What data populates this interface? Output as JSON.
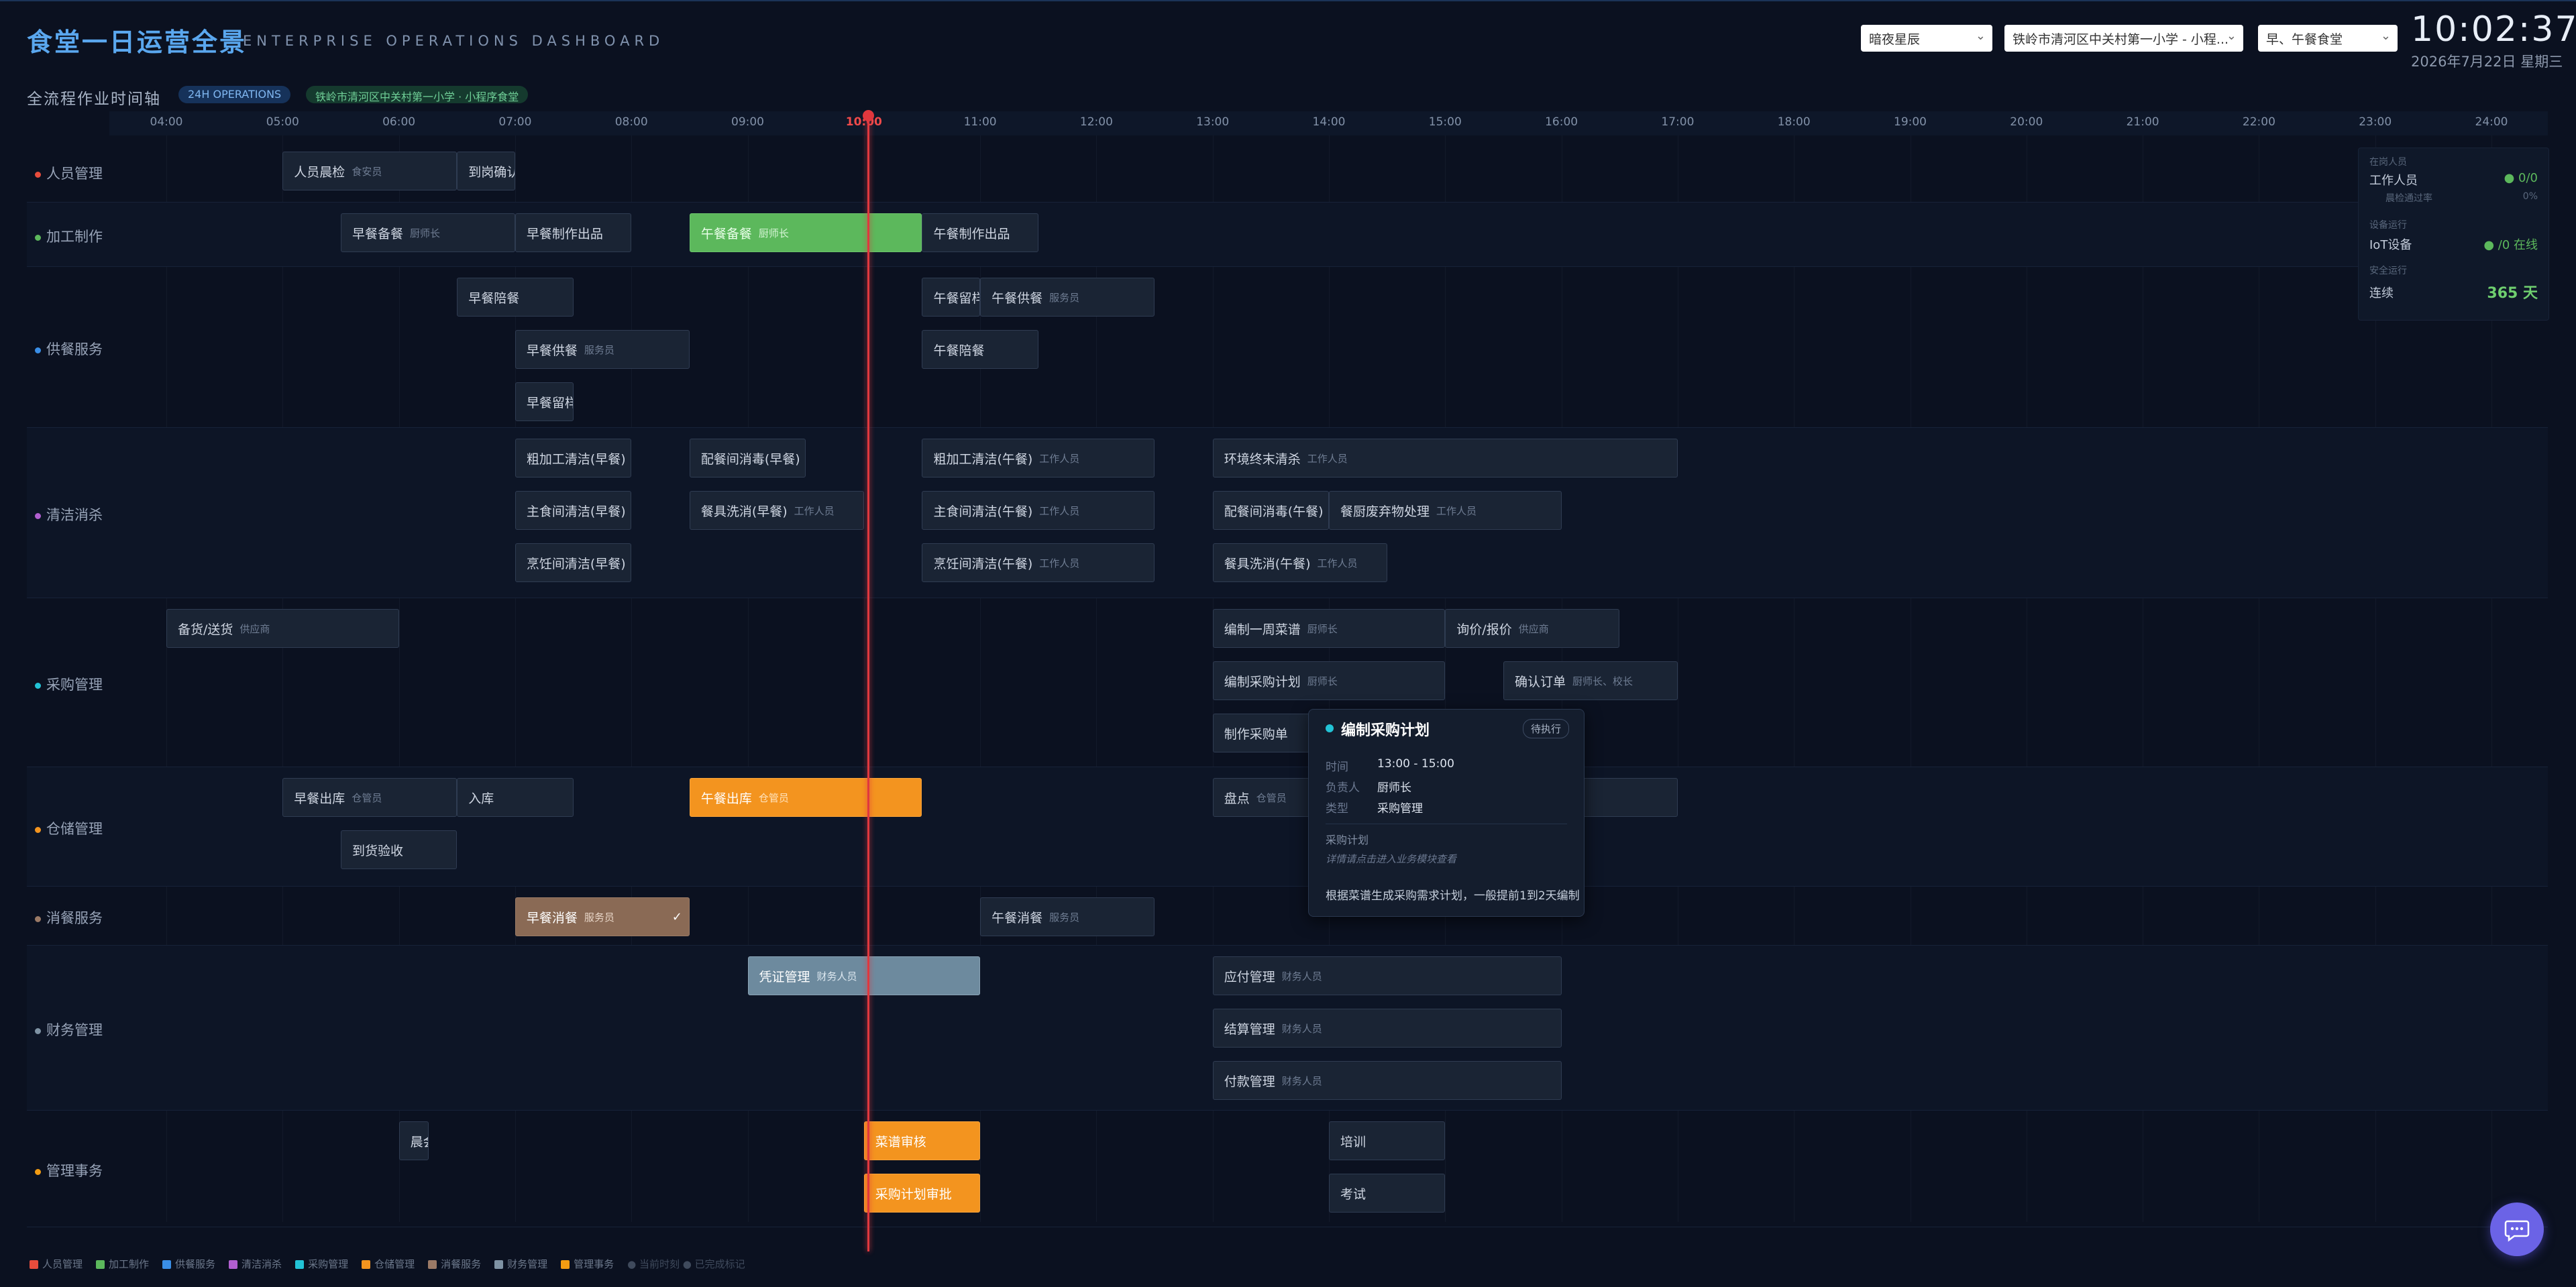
{
  "header": {
    "title": "食堂一日运营全景",
    "subtitle": "ENTERPRISE OPERATIONS DASHBOARD",
    "theme_select": "暗夜星辰",
    "school_select": "铁岭市清河区中关村第一小学 - 小程...",
    "meal_select": "早、午餐食堂",
    "clock": "10:02:37",
    "date": "2026年7月22日 星期三"
  },
  "subheader": {
    "label": "全流程作业时间轴",
    "pill_ops": "24H OPERATIONS",
    "pill_site": "铁岭市清河区中关村第一小学 · 小程序食堂"
  },
  "timeline": {
    "ticks": [
      "04:00",
      "05:00",
      "06:00",
      "07:00",
      "08:00",
      "09:00",
      "10:00",
      "11:00",
      "12:00",
      "13:00",
      "14:00",
      "15:00",
      "16:00",
      "17:00",
      "18:00",
      "19:00",
      "20:00",
      "21:00",
      "22:00",
      "23:00",
      "24:00"
    ],
    "now": "10:02"
  },
  "lanes": [
    {
      "name": "人员管理",
      "color": "#e74c3c"
    },
    {
      "name": "加工制作",
      "color": "#5cb85c"
    },
    {
      "name": "供餐服务",
      "color": "#3a8ee6"
    },
    {
      "name": "清洁消杀",
      "color": "#b15fd0"
    },
    {
      "name": "采购管理",
      "color": "#22c3d6"
    },
    {
      "name": "仓储管理",
      "color": "#f3941f"
    },
    {
      "name": "消餐服务",
      "color": "#9b7a66"
    },
    {
      "name": "财务管理",
      "color": "#7f93a4"
    },
    {
      "name": "管理事务",
      "color": "#f39c12"
    }
  ],
  "tasks": [
    {
      "lane": 0,
      "row": 0,
      "start": "05:00",
      "end": "06:30",
      "name": "人员晨检",
      "owner": "食安员",
      "style": "default"
    },
    {
      "lane": 0,
      "row": 0,
      "start": "06:30",
      "end": "07:00",
      "name": "到岗确认",
      "owner": "",
      "style": "default"
    },
    {
      "lane": 1,
      "row": 0,
      "start": "05:30",
      "end": "07:00",
      "name": "早餐备餐",
      "owner": "厨师长",
      "style": "default"
    },
    {
      "lane": 1,
      "row": 0,
      "start": "07:00",
      "end": "08:00",
      "name": "早餐制作出品",
      "owner": "",
      "style": "default"
    },
    {
      "lane": 1,
      "row": 0,
      "start": "08:30",
      "end": "10:30",
      "name": "午餐备餐",
      "owner": "厨师长",
      "style": "green"
    },
    {
      "lane": 1,
      "row": 0,
      "start": "10:30",
      "end": "11:30",
      "name": "午餐制作出品",
      "owner": "",
      "style": "default"
    },
    {
      "lane": 2,
      "row": 0,
      "start": "06:30",
      "end": "07:30",
      "name": "早餐陪餐",
      "owner": "",
      "style": "default"
    },
    {
      "lane": 2,
      "row": 0,
      "start": "10:30",
      "end": "11:00",
      "name": "午餐留样",
      "owner": "",
      "style": "default"
    },
    {
      "lane": 2,
      "row": 0,
      "start": "11:00",
      "end": "12:30",
      "name": "午餐供餐",
      "owner": "服务员",
      "style": "default"
    },
    {
      "lane": 2,
      "row": 1,
      "start": "07:00",
      "end": "08:30",
      "name": "早餐供餐",
      "owner": "服务员",
      "style": "default"
    },
    {
      "lane": 2,
      "row": 1,
      "start": "10:30",
      "end": "11:30",
      "name": "午餐陪餐",
      "owner": "",
      "style": "default"
    },
    {
      "lane": 2,
      "row": 2,
      "start": "07:00",
      "end": "07:30",
      "name": "早餐留样",
      "owner": "",
      "style": "default"
    },
    {
      "lane": 3,
      "row": 0,
      "start": "07:00",
      "end": "08:00",
      "name": "粗加工清洁(早餐)",
      "owner": "",
      "style": "default"
    },
    {
      "lane": 3,
      "row": 0,
      "start": "08:30",
      "end": "09:30",
      "name": "配餐间消毒(早餐)",
      "owner": "",
      "style": "default"
    },
    {
      "lane": 3,
      "row": 0,
      "start": "10:30",
      "end": "12:30",
      "name": "粗加工清洁(午餐)",
      "owner": "工作人员",
      "style": "default"
    },
    {
      "lane": 3,
      "row": 0,
      "start": "13:00",
      "end": "17:00",
      "name": "环境终末清杀",
      "owner": "工作人员",
      "style": "default"
    },
    {
      "lane": 3,
      "row": 1,
      "start": "07:00",
      "end": "08:00",
      "name": "主食间清洁(早餐)",
      "owner": "",
      "style": "default"
    },
    {
      "lane": 3,
      "row": 1,
      "start": "08:30",
      "end": "10:00",
      "name": "餐具洗消(早餐)",
      "owner": "工作人员",
      "style": "default"
    },
    {
      "lane": 3,
      "row": 1,
      "start": "10:30",
      "end": "12:30",
      "name": "主食间清洁(午餐)",
      "owner": "工作人员",
      "style": "default"
    },
    {
      "lane": 3,
      "row": 1,
      "start": "13:00",
      "end": "14:00",
      "name": "配餐间消毒(午餐)",
      "owner": "",
      "style": "default"
    },
    {
      "lane": 3,
      "row": 1,
      "start": "14:00",
      "end": "16:00",
      "name": "餐厨废弃物处理",
      "owner": "工作人员",
      "style": "default"
    },
    {
      "lane": 3,
      "row": 2,
      "start": "07:00",
      "end": "08:00",
      "name": "烹饪间清洁(早餐)",
      "owner": "",
      "style": "default"
    },
    {
      "lane": 3,
      "row": 2,
      "start": "10:30",
      "end": "12:30",
      "name": "烹饪间清洁(午餐)",
      "owner": "工作人员",
      "style": "default"
    },
    {
      "lane": 3,
      "row": 2,
      "start": "13:00",
      "end": "14:30",
      "name": "餐具洗消(午餐)",
      "owner": "工作人员",
      "style": "default"
    },
    {
      "lane": 4,
      "row": 0,
      "start": "04:00",
      "end": "06:00",
      "name": "备货/送货",
      "owner": "供应商",
      "style": "default"
    },
    {
      "lane": 4,
      "row": 0,
      "start": "13:00",
      "end": "15:00",
      "name": "编制一周菜谱",
      "owner": "厨师长",
      "style": "default"
    },
    {
      "lane": 4,
      "row": 0,
      "start": "15:00",
      "end": "16:30",
      "name": "询价/报价",
      "owner": "供应商",
      "style": "default"
    },
    {
      "lane": 4,
      "row": 1,
      "start": "13:00",
      "end": "15:00",
      "name": "编制采购计划",
      "owner": "厨师长",
      "style": "default"
    },
    {
      "lane": 4,
      "row": 1,
      "start": "15:30",
      "end": "17:00",
      "name": "确认订单",
      "owner": "厨师长、校长",
      "style": "default"
    },
    {
      "lane": 4,
      "row": 2,
      "start": "13:00",
      "end": "14:00",
      "name": "制作采购单",
      "owner": "",
      "style": "default"
    },
    {
      "lane": 5,
      "row": 0,
      "start": "05:00",
      "end": "06:30",
      "name": "早餐出库",
      "owner": "仓管员",
      "style": "default"
    },
    {
      "lane": 5,
      "row": 0,
      "start": "06:30",
      "end": "07:30",
      "name": "入库",
      "owner": "",
      "style": "default"
    },
    {
      "lane": 5,
      "row": 0,
      "start": "08:30",
      "end": "10:30",
      "name": "午餐出库",
      "owner": "仓管员",
      "style": "orange"
    },
    {
      "lane": 5,
      "row": 0,
      "start": "13:00",
      "end": "17:00",
      "name": "盘点",
      "owner": "仓管员",
      "style": "default"
    },
    {
      "lane": 5,
      "row": 1,
      "start": "05:30",
      "end": "06:30",
      "name": "到货验收",
      "owner": "",
      "style": "default"
    },
    {
      "lane": 6,
      "row": 0,
      "start": "07:00",
      "end": "08:30",
      "name": "早餐消餐",
      "owner": "服务员",
      "style": "brown",
      "done": "✓"
    },
    {
      "lane": 6,
      "row": 0,
      "start": "11:00",
      "end": "12:30",
      "name": "午餐消餐",
      "owner": "服务员",
      "style": "default"
    },
    {
      "lane": 7,
      "row": 0,
      "start": "09:00",
      "end": "11:00",
      "name": "凭证管理",
      "owner": "财务人员",
      "style": "steel"
    },
    {
      "lane": 7,
      "row": 0,
      "start": "13:00",
      "end": "16:00",
      "name": "应付管理",
      "owner": "财务人员",
      "style": "default"
    },
    {
      "lane": 7,
      "row": 1,
      "start": "13:00",
      "end": "16:00",
      "name": "结算管理",
      "owner": "财务人员",
      "style": "default"
    },
    {
      "lane": 7,
      "row": 2,
      "start": "13:00",
      "end": "16:00",
      "name": "付款管理",
      "owner": "财务人员",
      "style": "default"
    },
    {
      "lane": 8,
      "row": 0,
      "start": "06:00",
      "end": "06:15",
      "name": "晨会",
      "owner": "",
      "style": "default"
    },
    {
      "lane": 8,
      "row": 0,
      "start": "10:00",
      "end": "11:00",
      "name": "菜谱审核",
      "owner": "",
      "style": "orange"
    },
    {
      "lane": 8,
      "row": 0,
      "start": "14:00",
      "end": "15:00",
      "name": "培训",
      "owner": "",
      "style": "default"
    },
    {
      "lane": 8,
      "row": 1,
      "start": "10:00",
      "end": "11:00",
      "name": "采购计划审批",
      "owner": "",
      "style": "orange"
    },
    {
      "lane": 8,
      "row": 1,
      "start": "14:00",
      "end": "15:00",
      "name": "考试",
      "owner": "",
      "style": "default"
    }
  ],
  "stats": {
    "sec_staff": "在岗人员",
    "staff_label": "工作人员",
    "staff_value": "● 0/0",
    "staff_sub_label": "晨检通过率",
    "staff_sub_value": "0%",
    "sec_device": "设备运行",
    "device_label": "IoT设备",
    "device_value": "● /0 在线",
    "sec_safety": "安全运行",
    "safety_label": "连续",
    "safety_value": "365 天"
  },
  "tooltip": {
    "title": "编制采购计划",
    "status": "待执行",
    "time_label": "时间",
    "time_value": "13:00 - 15:00",
    "owner_label": "负责人",
    "owner_value": "厨师长",
    "type_label": "类型",
    "type_value": "采购管理",
    "section": "采购计划",
    "hint": "详情请点击进入业务模块查看",
    "desc": "根据菜谱生成采购需求计划，一般提前1到2天编制"
  },
  "legend": {
    "items": [
      {
        "name": "人员管理",
        "color": "#e74c3c"
      },
      {
        "name": "加工制作",
        "color": "#5cb85c"
      },
      {
        "name": "供餐服务",
        "color": "#3a8ee6"
      },
      {
        "name": "清洁消杀",
        "color": "#b15fd0"
      },
      {
        "name": "采购管理",
        "color": "#22c3d6"
      },
      {
        "name": "仓储管理",
        "color": "#f3941f"
      },
      {
        "name": "消餐服务",
        "color": "#9b7a66"
      },
      {
        "name": "财务管理",
        "color": "#7f93a4"
      },
      {
        "name": "管理事务",
        "color": "#f39c12"
      }
    ],
    "note": "● 当前时刻 ● 已完成标记"
  }
}
